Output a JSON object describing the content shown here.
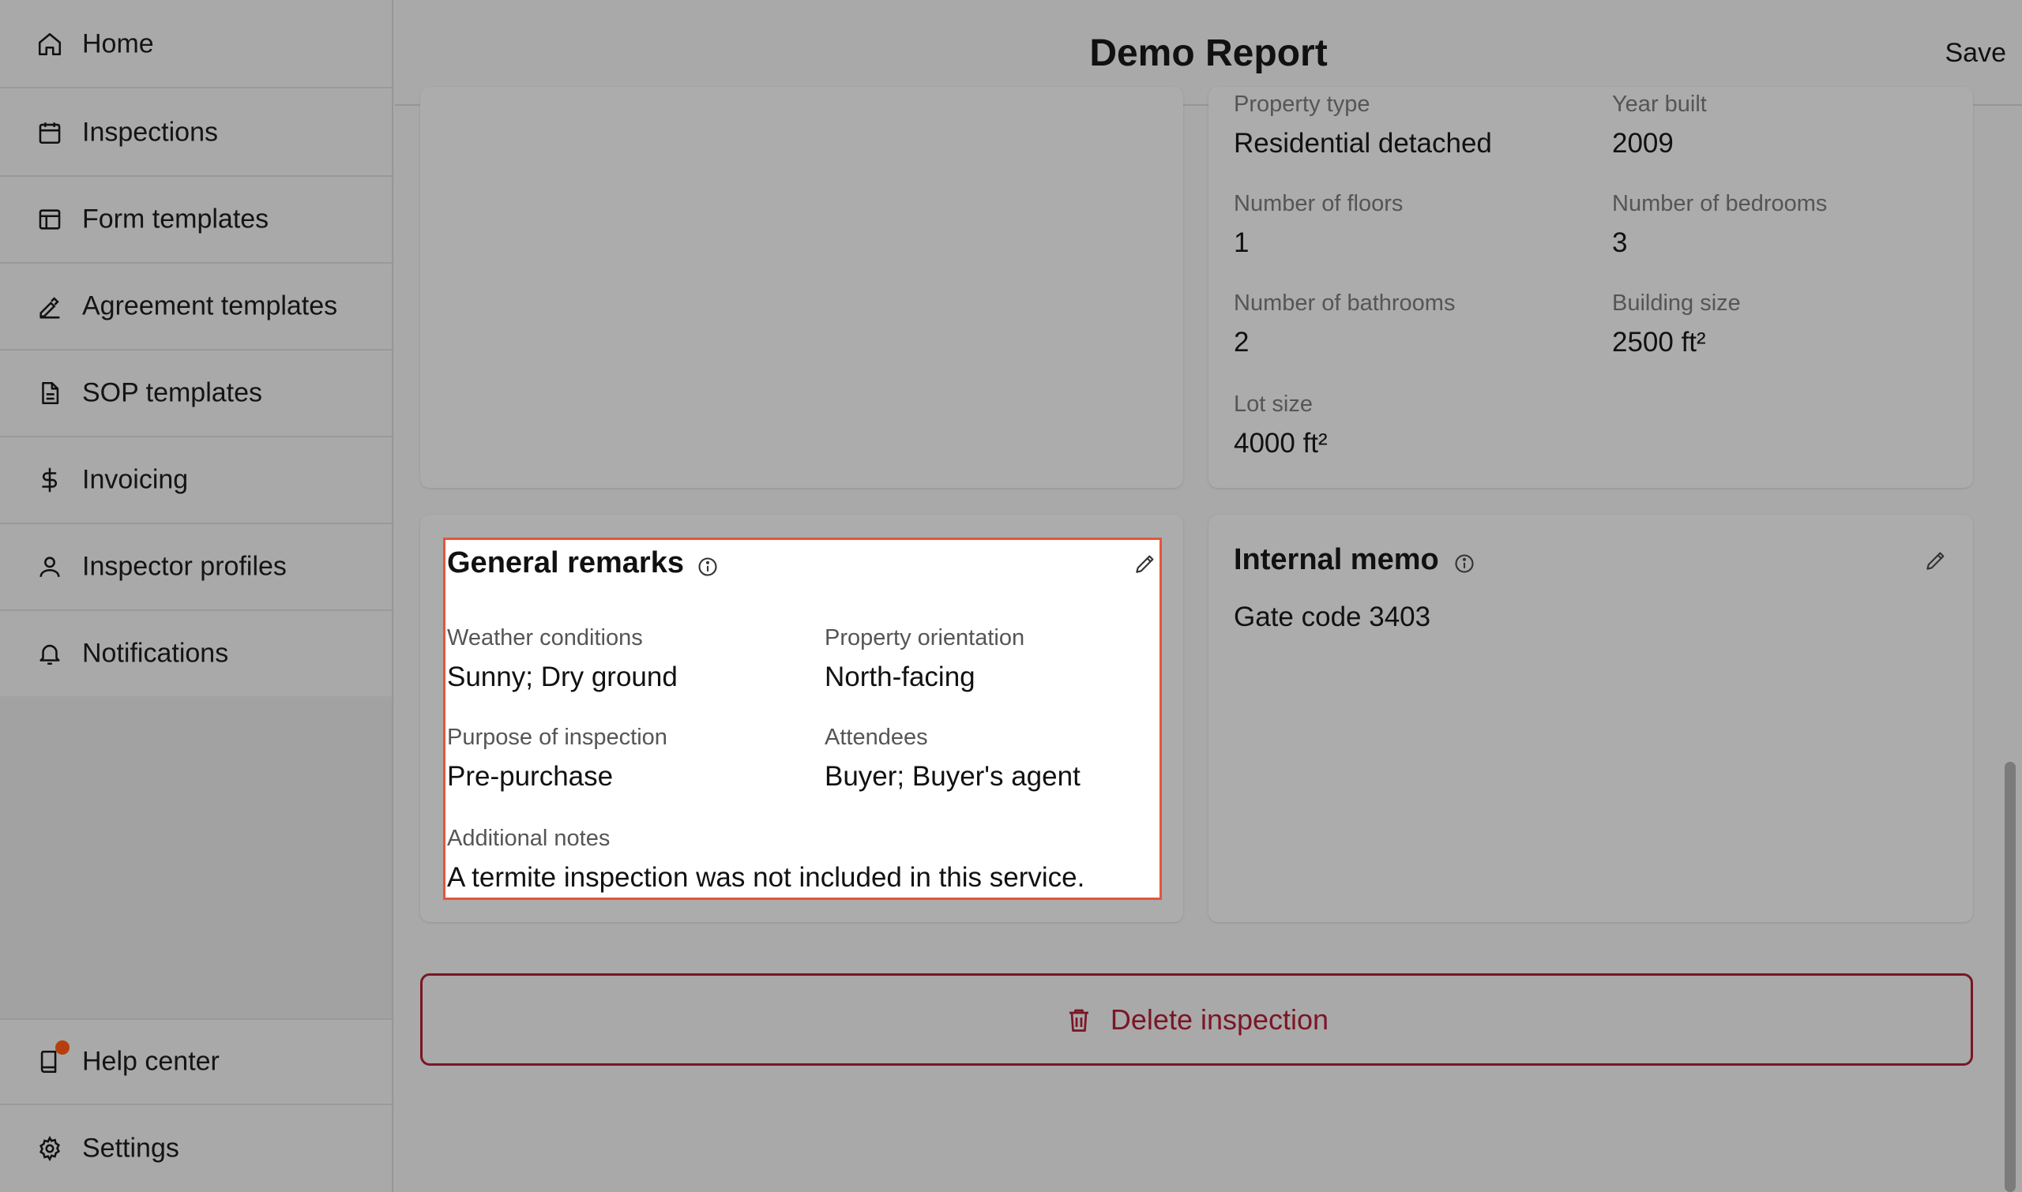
{
  "header": {
    "title": "Demo Report",
    "save_label": "Save"
  },
  "sidebar": {
    "items": [
      {
        "label": "Home",
        "icon": "home-icon"
      },
      {
        "label": "Inspections",
        "icon": "calendar-icon"
      },
      {
        "label": "Form templates",
        "icon": "layout-icon"
      },
      {
        "label": "Agreement templates",
        "icon": "signature-icon"
      },
      {
        "label": "SOP templates",
        "icon": "document-icon"
      },
      {
        "label": "Invoicing",
        "icon": "dollar-icon"
      },
      {
        "label": "Inspector profiles",
        "icon": "user-icon"
      },
      {
        "label": "Notifications",
        "icon": "bell-icon"
      }
    ],
    "bottom": [
      {
        "label": "Help center",
        "icon": "book-icon"
      },
      {
        "label": "Settings",
        "icon": "gear-icon"
      }
    ]
  },
  "property": {
    "type_label": "Property type",
    "type_value": "Residential detached",
    "year_label": "Year built",
    "year_value": "2009",
    "floors_label": "Number of floors",
    "floors_value": "1",
    "bedrooms_label": "Number of bedrooms",
    "bedrooms_value": "3",
    "bathrooms_label": "Number of bathrooms",
    "bathrooms_value": "2",
    "size_label": "Building size",
    "size_value": "2500 ft²",
    "lot_label": "Lot size",
    "lot_value": "4000 ft²"
  },
  "remarks": {
    "title": "General remarks",
    "weather_label": "Weather conditions",
    "weather_value": "Sunny; Dry ground",
    "orientation_label": "Property orientation",
    "orientation_value": "North-facing",
    "purpose_label": "Purpose of inspection",
    "purpose_value": "Pre-purchase",
    "attendees_label": "Attendees",
    "attendees_value": "Buyer; Buyer's agent",
    "notes_label": "Additional notes",
    "notes_value": "A termite inspection was not included in this service."
  },
  "memo": {
    "title": "Internal memo",
    "value": "Gate code 3403"
  },
  "delete_label": "Delete inspection",
  "colors": {
    "highlight_border": "#e4553b",
    "danger": "#7a1625",
    "notification_dot": "#b5400d"
  }
}
